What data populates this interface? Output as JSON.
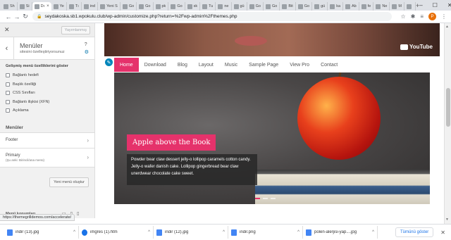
{
  "browser": {
    "tabs": [
      {
        "label": "Sh"
      },
      {
        "label": "Si"
      },
      {
        "label": "Dı"
      },
      {
        "label": "Ye"
      },
      {
        "label": "Tı"
      },
      {
        "label": "ind"
      },
      {
        "label": "Yeni S"
      },
      {
        "label": "Go"
      },
      {
        "label": "Go"
      },
      {
        "label": "pk"
      },
      {
        "label": "Go"
      },
      {
        "label": "sk"
      },
      {
        "label": "Tu"
      },
      {
        "label": "ne"
      },
      {
        "label": "gü"
      },
      {
        "label": "Go"
      },
      {
        "label": "Go"
      },
      {
        "label": "Bit"
      },
      {
        "label": "Go"
      },
      {
        "label": "gü"
      },
      {
        "label": "ka"
      },
      {
        "label": "Ab"
      },
      {
        "label": "fe"
      },
      {
        "label": "Ne"
      },
      {
        "label": "M"
      },
      {
        "label": ""
      }
    ],
    "url": "seydakoska.sb1.wpokulu.club/wp-admin/customize.php?return=%2Fwp-admin%2Fthemes.php",
    "profile_initial": "P",
    "status_url": "https://themegrilldemos.com/accelerate/"
  },
  "sidebar": {
    "publish_label": "Yayımlanmış",
    "title": "Menüler",
    "subtitle": "sitesini özelleştiriyorsunuz",
    "advanced_title": "Gelişmiş menü özelliklerini göster",
    "options": [
      "Bağlantı hedefi",
      "Başlık özelliği",
      "CSS Sınıfları",
      "Bağlantı ilişkisi (XFN)",
      "Açıklama"
    ],
    "menus_label": "Menüler",
    "menus": [
      {
        "name": "Footer",
        "sub": ""
      },
      {
        "name": "Primary",
        "sub": "(Şu anki: Birincil/ana menü)"
      }
    ],
    "new_menu_label": "Yeni menü oluştur",
    "bottom_label": "Menü konumları",
    "bottom_sub": "Kontrolleri gizle"
  },
  "preview": {
    "youtube_label": "YouTube",
    "nav": [
      "Home",
      "Download",
      "Blog",
      "Layout",
      "Music",
      "Sample Page",
      "View Pro",
      "Contact"
    ],
    "active_nav": "Home",
    "slide_title": "Apple above the Book",
    "slide_text": "Powder bear claw dessert jelly-o lollipop caramels cotton candy. Jelly-o wafer danish cake. Lollipop gingerbread bear claw unerdwear chocolate cake sweet.",
    "accent_color": "#e5326b"
  },
  "downloads": [
    {
      "name": "indir (13).jpg",
      "icon": "image-file-icon"
    },
    {
      "name": "imgres (1).htm",
      "icon": "web-file-icon"
    },
    {
      "name": "indir (12).jpg",
      "icon": "image-file-icon"
    },
    {
      "name": "indir.png",
      "icon": "image-file-icon"
    },
    {
      "name": "polen-alerjisi-yap....jpg",
      "icon": "image-file-icon"
    }
  ],
  "show_all_label": "Tümünü göster"
}
